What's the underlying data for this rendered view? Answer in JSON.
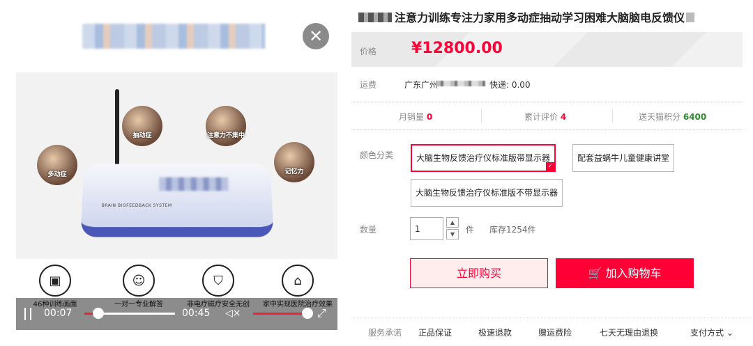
{
  "video": {
    "feature_bubbles": [
      "抽动症",
      "注意力不集中",
      "多动症",
      "记忆力"
    ],
    "device_label": "BRAIN BIOFEEDBACK SYSTEM",
    "features": [
      {
        "icon": "image-46-icon",
        "caption": "46种训练画面"
      },
      {
        "icon": "people-icon",
        "caption": "一对一专业解答"
      },
      {
        "icon": "shield-icon",
        "caption": "非电疗磁疗安全无创"
      },
      {
        "icon": "home-icon",
        "caption": "家中实现医院治疗效果"
      }
    ],
    "current_time": "00:07",
    "total_time": "00:45",
    "progress_fraction": 0.12,
    "volume_fraction": 0.88
  },
  "product": {
    "title": "注意力训练专注力家用多动症抽动学习困难大脑脑电反馈仪",
    "price_label": "价格",
    "price": "¥12800.00",
    "shipping_label": "运费",
    "ship_from": "广东广州",
    "ship_fee": "快递: 0.00",
    "stats": {
      "monthly_sales_label": "月销量",
      "monthly_sales": "0",
      "reviews_label": "累计评价",
      "reviews": "4",
      "points_label": "送天猫积分",
      "points": "6400"
    },
    "color_label": "颜色分类",
    "options": [
      "大脑生物反馈治疗仪标准版带显示器",
      "配套益蜗牛儿童健康讲堂",
      "大脑生物反馈治疗仪标准版不带显示器"
    ],
    "quantity_label": "数量",
    "quantity": "1",
    "unit": "件",
    "stock": "库存1254件",
    "buy_now": "立即购买",
    "add_cart": "加入购物车",
    "service_label": "服务承诺",
    "services": [
      "正品保证",
      "极速退款",
      "赠运费险",
      "七天无理由退换"
    ],
    "payment_label": "支付方式"
  },
  "colors": {
    "accent": "#ff0036",
    "points_green": "#2e8b2e"
  }
}
